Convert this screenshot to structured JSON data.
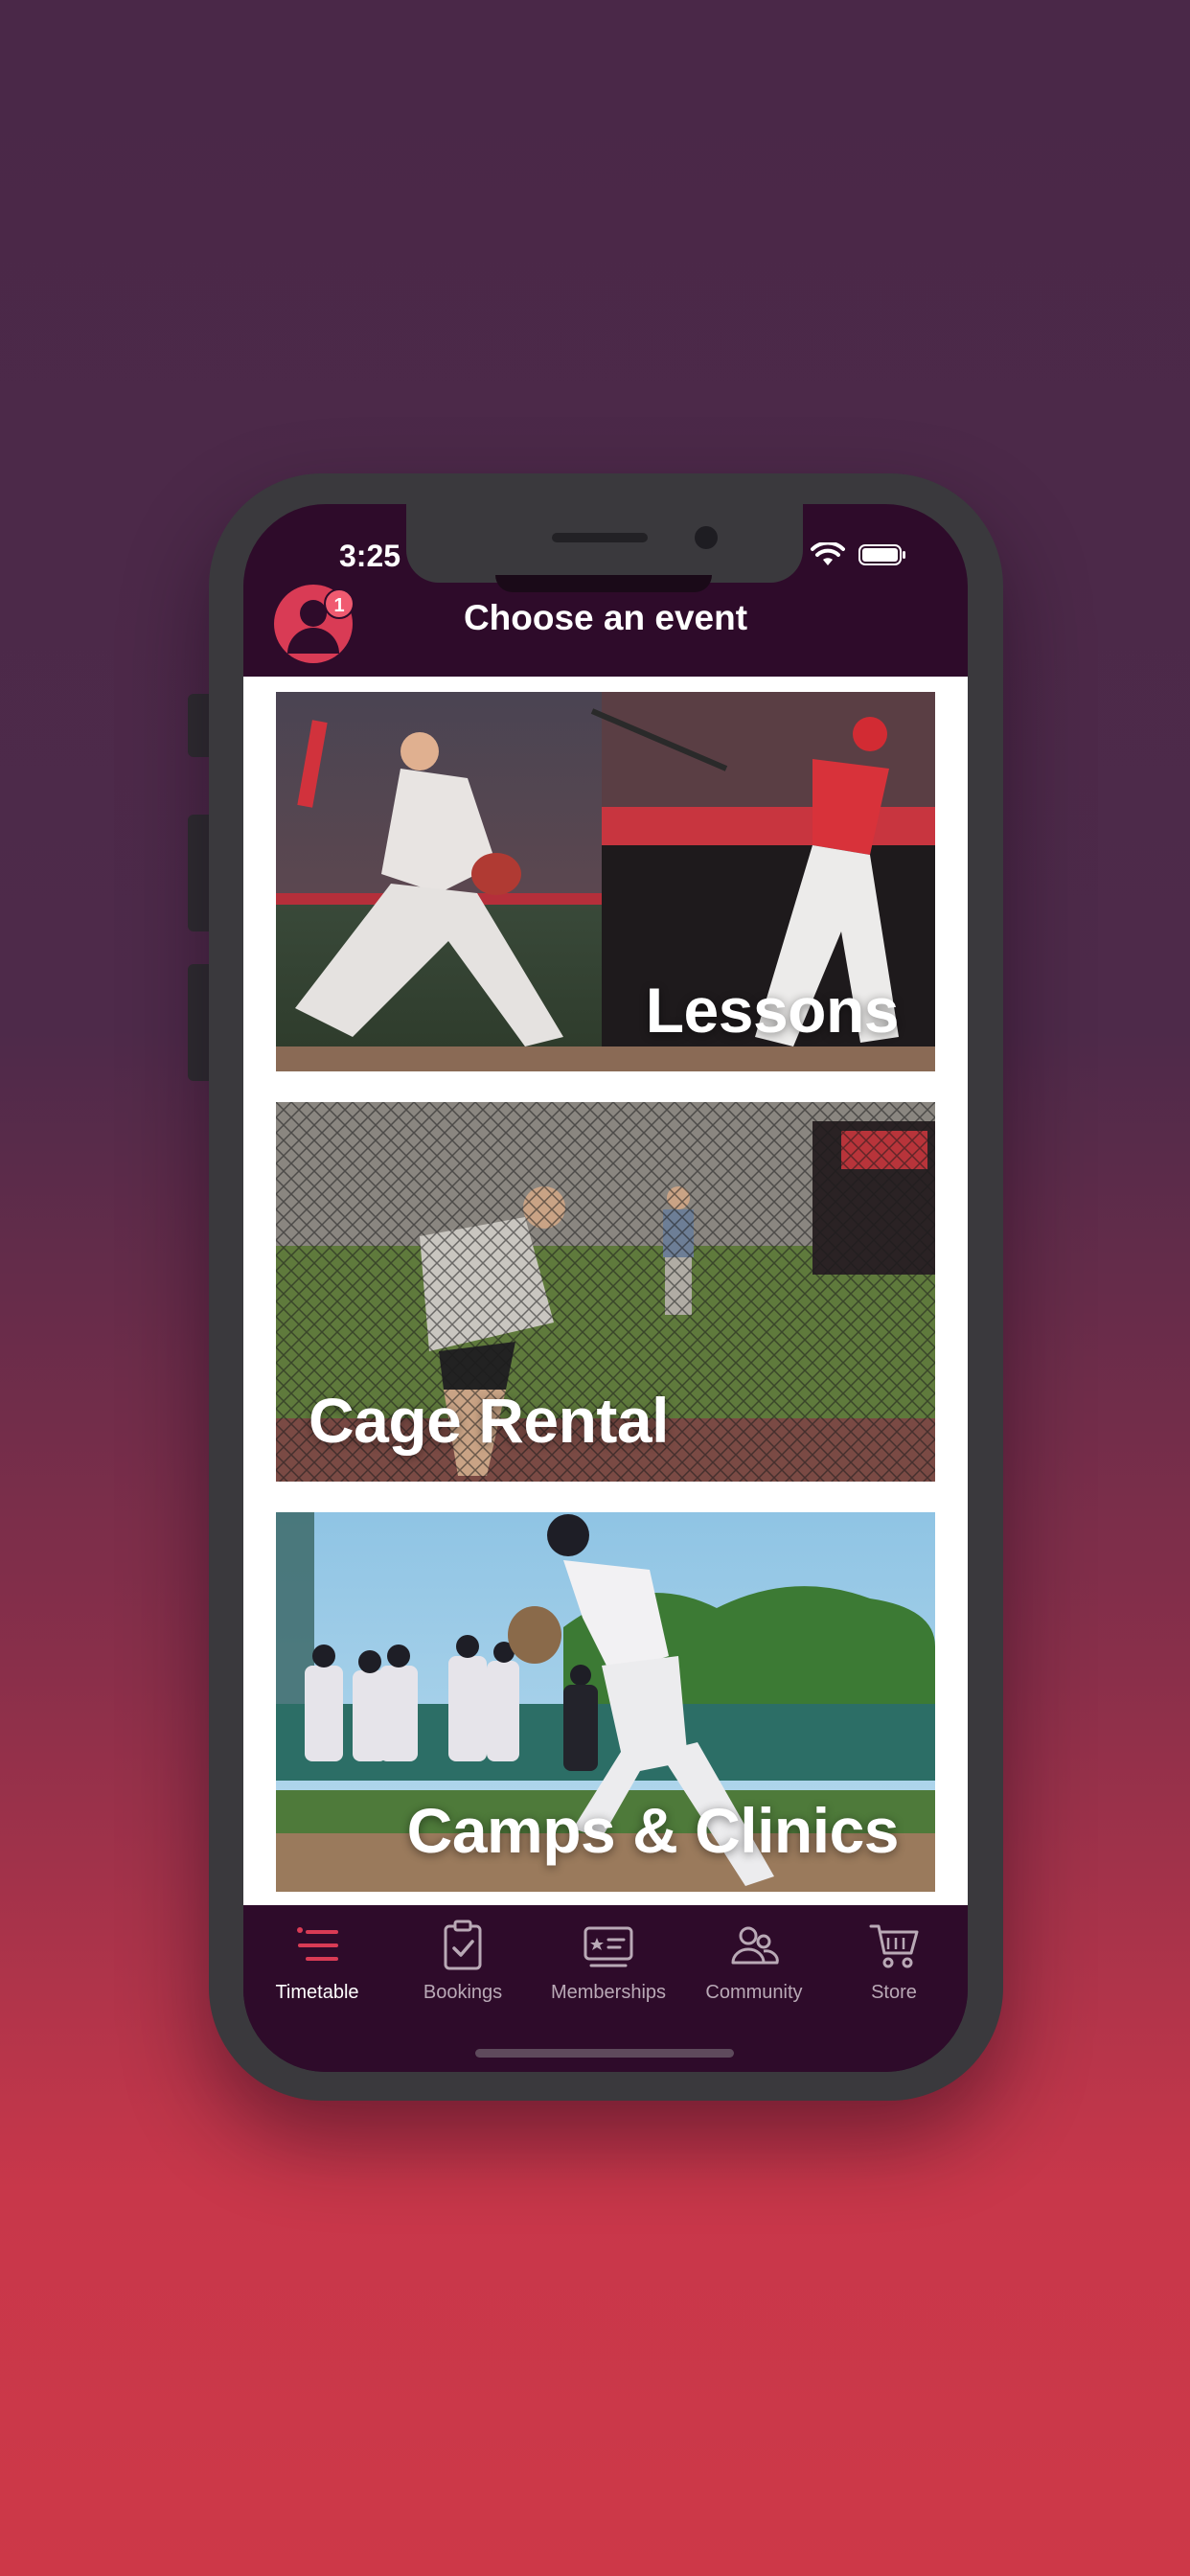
{
  "status_bar": {
    "time": "3:25"
  },
  "header": {
    "title": "Choose an event",
    "notification_count": "1"
  },
  "events": [
    {
      "title": "Lessons"
    },
    {
      "title": "Cage Rental"
    },
    {
      "title": "Camps & Clinics"
    }
  ],
  "tabbar": {
    "active": "Timetable",
    "items": [
      {
        "label": "Timetable",
        "icon": "list-icon"
      },
      {
        "label": "Bookings",
        "icon": "clipboard-check-icon"
      },
      {
        "label": "Memberships",
        "icon": "membership-card-icon"
      },
      {
        "label": "Community",
        "icon": "people-icon"
      },
      {
        "label": "Store",
        "icon": "cart-icon"
      }
    ]
  },
  "colors": {
    "accent": "#d93b55",
    "header_bg": "#2e0b2a",
    "background_top": "#4a2848",
    "background_bottom": "#cd3848"
  }
}
